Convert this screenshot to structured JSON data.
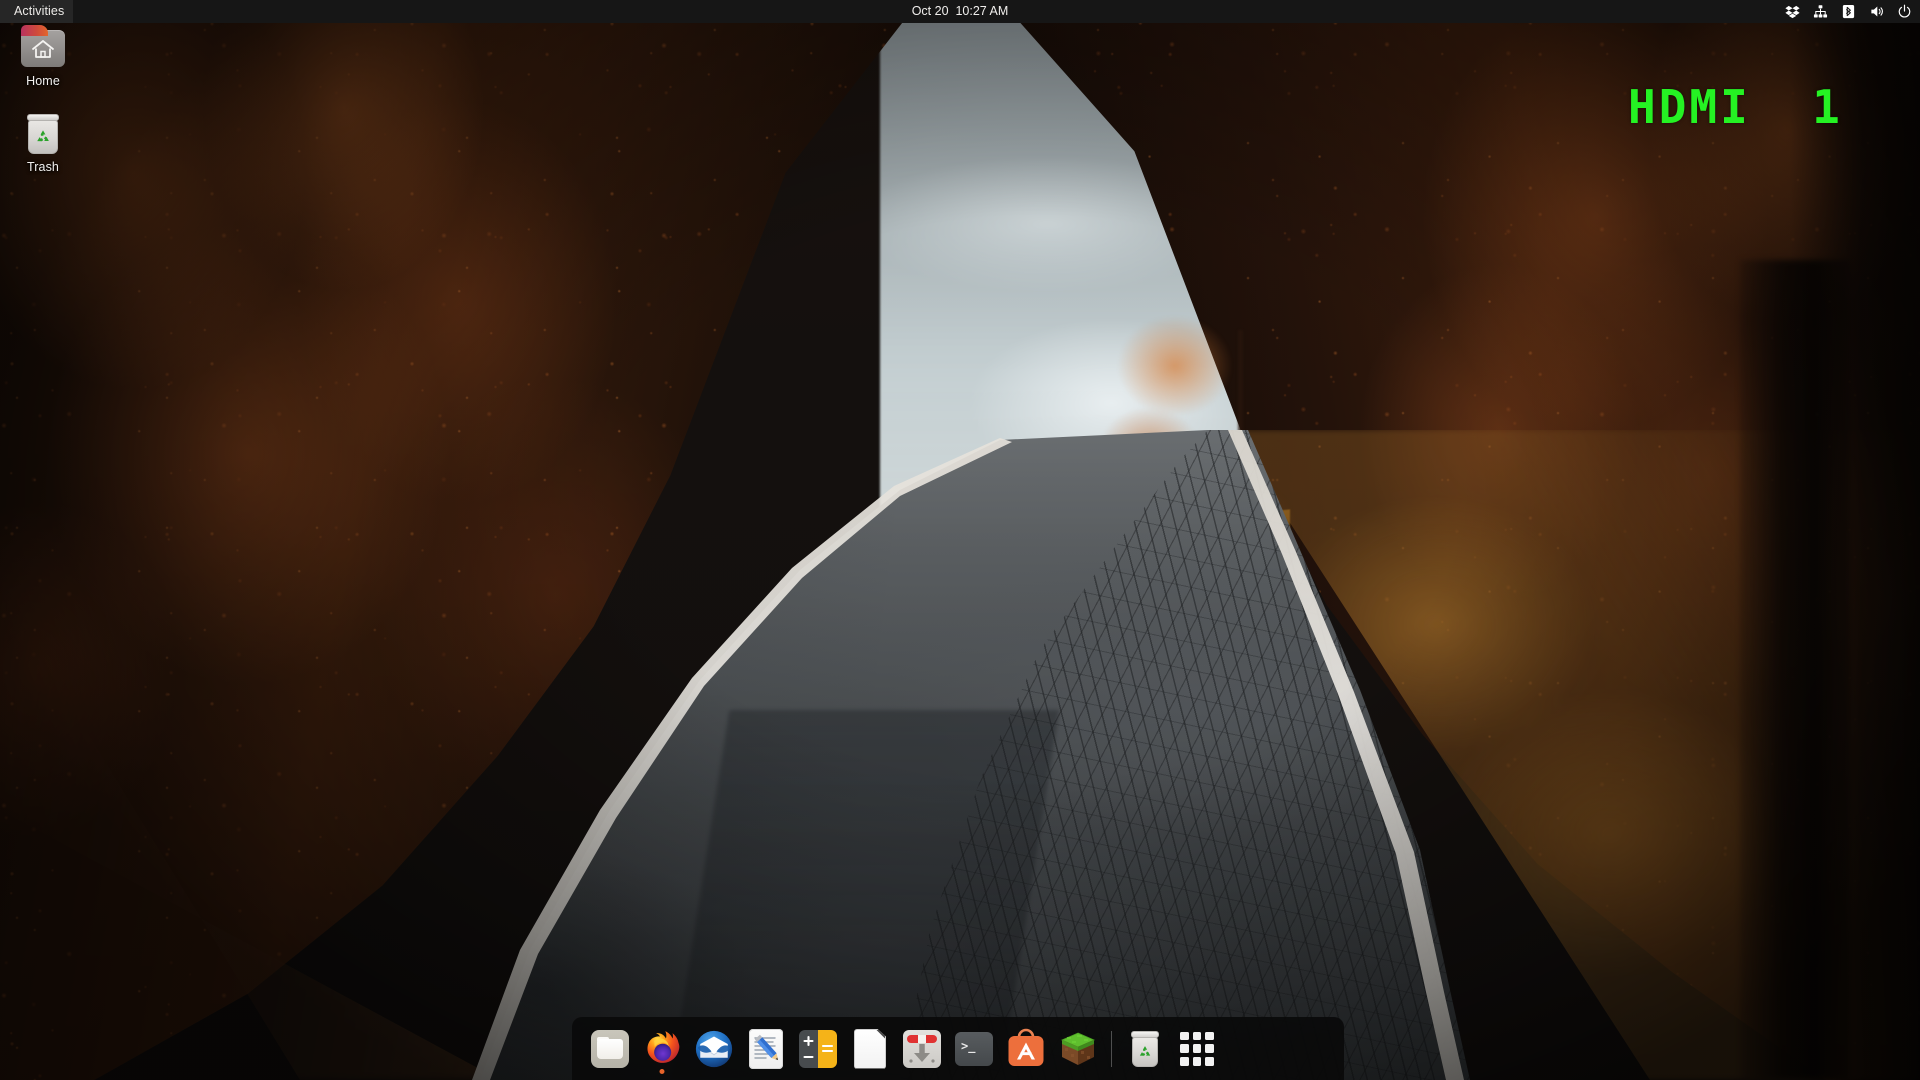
{
  "topbar": {
    "activities_label": "Activities",
    "clock": "Oct 20  10:27 AM",
    "tray_icons": [
      {
        "name": "dropbox-icon",
        "label": "Dropbox"
      },
      {
        "name": "network-wired-icon",
        "label": "Wired Network"
      },
      {
        "name": "bluetooth-icon",
        "label": "Bluetooth"
      },
      {
        "name": "volume-icon",
        "label": "Volume"
      },
      {
        "name": "power-icon",
        "label": "Power"
      }
    ],
    "bar_color": "#161616",
    "text_color": "#e8e6e3"
  },
  "desktop_icons": [
    {
      "name": "home-folder-icon",
      "label": "Home"
    },
    {
      "name": "trash-icon",
      "label": "Trash"
    }
  ],
  "osd": {
    "text": "HDMI  1",
    "color": "#25f223"
  },
  "dock": {
    "background": "#0a0a0a",
    "items": [
      {
        "name": "dock-item-files",
        "label": "Files",
        "icon": "folder-icon",
        "running": false
      },
      {
        "name": "dock-item-firefox",
        "label": "Firefox",
        "icon": "firefox-icon",
        "running": true
      },
      {
        "name": "dock-item-thunderbird",
        "label": "Thunderbird",
        "icon": "thunderbird-icon",
        "running": false
      },
      {
        "name": "dock-item-text-editor",
        "label": "Text Editor",
        "icon": "text-editor-icon",
        "running": false
      },
      {
        "name": "dock-item-calculator",
        "label": "Calculator",
        "icon": "calculator-icon",
        "running": false
      },
      {
        "name": "dock-item-libreoffice",
        "label": "LibreOffice Writer",
        "icon": "document-icon",
        "running": false
      },
      {
        "name": "dock-item-software-updater",
        "label": "Software Updater",
        "icon": "software-updater-icon",
        "running": false
      },
      {
        "name": "dock-item-terminal",
        "label": "Terminal",
        "icon": "terminal-icon",
        "running": false
      },
      {
        "name": "dock-item-ubuntu-software",
        "label": "Ubuntu Software",
        "icon": "ubuntu-software-icon",
        "running": false
      },
      {
        "name": "dock-item-minecraft",
        "label": "Minecraft",
        "icon": "minecraft-icon",
        "running": false
      }
    ],
    "trailing": [
      {
        "name": "dock-item-trash",
        "label": "Trash",
        "icon": "trash-icon"
      },
      {
        "name": "dock-item-show-applications",
        "label": "Show Applications",
        "icon": "apps-grid-icon"
      }
    ],
    "terminal_prompt": ">_"
  },
  "wallpaper": {
    "description": "Autumn forest road",
    "sky_color": "#c2cdd0",
    "foliage_color": "#a8542a",
    "road_color": "#4e5255"
  }
}
